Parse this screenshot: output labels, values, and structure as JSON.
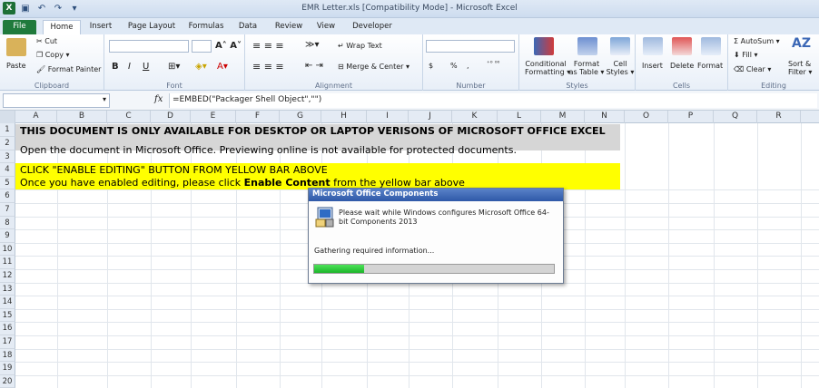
{
  "window": {
    "title": "EMR Letter.xls  [Compatibility Mode]  -  Microsoft Excel"
  },
  "tabs": [
    "File",
    "Home",
    "Insert",
    "Page Layout",
    "Formulas",
    "Data",
    "Review",
    "View",
    "Developer"
  ],
  "ribbon": {
    "clipboard": {
      "paste": "Paste",
      "cut": "Cut",
      "copy": "Copy",
      "format_painter": "Format Painter",
      "label": "Clipboard"
    },
    "font": {
      "label": "Font",
      "bold": "B",
      "italic": "I",
      "underline": "U"
    },
    "alignment": {
      "wrap": "Wrap Text",
      "merge": "Merge & Center",
      "label": "Alignment"
    },
    "number": {
      "label": "Number",
      "currency": "$",
      "percent": "%",
      "comma": ","
    },
    "styles": {
      "cond1": "Conditional",
      "cond2": "Formatting",
      "fmt1": "Format",
      "fmt2": "as Table",
      "cell1": "Cell",
      "cell2": "Styles",
      "label": "Styles"
    },
    "cells": {
      "insert": "Insert",
      "delete": "Delete",
      "format": "Format",
      "label": "Cells"
    },
    "editing": {
      "autosum": "AutoSum",
      "fill": "Fill",
      "clear": "Clear",
      "sort1": "Sort &",
      "sort2": "Filter",
      "label": "Editing"
    }
  },
  "formula_bar": {
    "fx": "fx",
    "formula": "=EMBED(\"Packager Shell Object\",\"\")"
  },
  "columns": [
    "A",
    "B",
    "C",
    "D",
    "E",
    "F",
    "G",
    "H",
    "I",
    "J",
    "K",
    "L",
    "M",
    "N",
    "O",
    "P",
    "Q",
    "R"
  ],
  "rows": [
    "1",
    "2",
    "3",
    "4",
    "5",
    "6",
    "7",
    "8",
    "9",
    "10",
    "11",
    "12",
    "13",
    "14",
    "15",
    "16",
    "17",
    "18",
    "19",
    "20"
  ],
  "cells": {
    "row1": "THIS DOCUMENT IS ONLY AVAILABLE FOR DESKTOP OR LAPTOP VERISONS OF MICROSOFT OFFICE EXCEL",
    "row2": "Open the document in Microsoft Office. Previewing online is not available for protected documents.",
    "row4": "CLICK \"ENABLE EDITING\" BUTTON FROM YELLOW BAR ABOVE",
    "row5_pre": "Once you have enabled editing, please click ",
    "row5_bold": "Enable Content",
    "row5_post": " from the yellow bar above"
  },
  "dialog": {
    "title": "Microsoft Office Components",
    "message": "Please wait while Windows configures Microsoft Office 64-bit Components 2013",
    "status": "Gathering required information...",
    "progress": 0.21
  },
  "colors": {
    "file_tab": "#1f7a3c",
    "yellow_fill": "#ffff00",
    "gray_fill": "#d6d6d6",
    "progress": "#2ccf3a"
  }
}
